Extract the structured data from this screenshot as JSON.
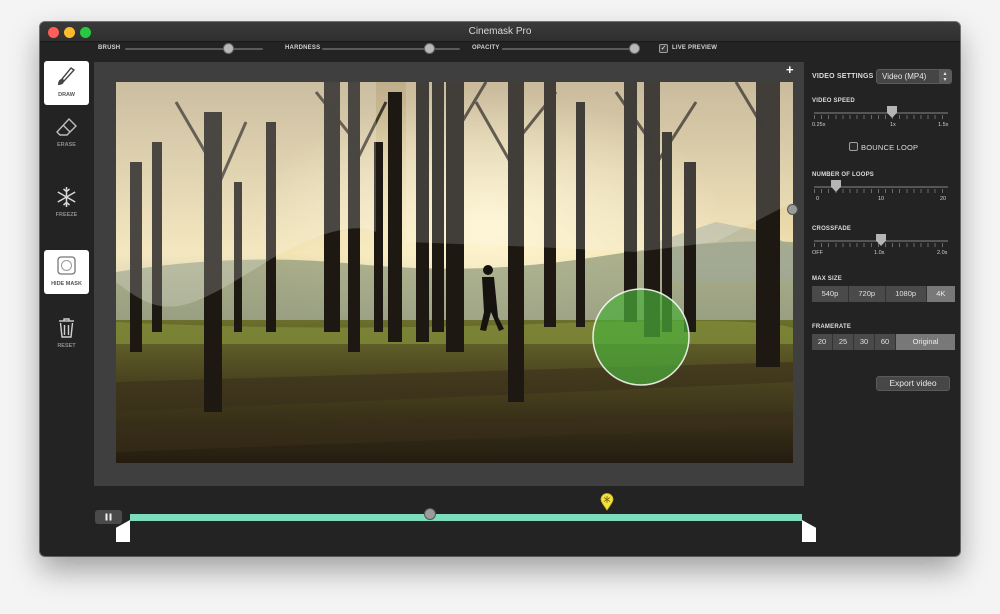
{
  "window": {
    "title": "Cinemask Pro"
  },
  "toolbar": {
    "brush_label": "BRUSH",
    "hardness_label": "HARDNESS",
    "opacity_label": "OPACITY",
    "live_preview_label": "LIVE PREVIEW",
    "live_preview_checked": true
  },
  "tools": [
    {
      "label": "DRAW",
      "icon": "brush-icon",
      "active": true
    },
    {
      "label": "ERASE",
      "icon": "eraser-icon",
      "active": false
    },
    {
      "label": "FREEZE",
      "icon": "snowflake-icon",
      "active": false
    },
    {
      "label": "HIDE MASK",
      "icon": "hide-mask-icon",
      "active": true
    },
    {
      "label": "RESET",
      "icon": "trash-icon",
      "active": false
    }
  ],
  "panel": {
    "video_settings_label": "VIDEO SETTINGS",
    "format_value": "Video (MP4)",
    "video_speed": {
      "label": "VIDEO SPEED",
      "min": "0.25x",
      "mid": "1x",
      "max": "1.5x"
    },
    "bounce_loop": {
      "label": "BOUNCE LOOP",
      "checked": false
    },
    "loops": {
      "label": "NUMBER OF LOOPS",
      "min": "0",
      "mid": "10",
      "max": "20"
    },
    "crossfade": {
      "label": "CROSSFADE",
      "min": "OFF",
      "mid": "1.0s",
      "max": "2.0s"
    },
    "max_size": {
      "label": "MAX SIZE",
      "options": [
        "540p",
        "720p",
        "1080p",
        "4K"
      ],
      "selected": "4K"
    },
    "framerate": {
      "label": "FRAMERATE",
      "options": [
        "20",
        "25",
        "30",
        "60",
        "Original"
      ],
      "selected": "Original"
    },
    "export_label": "Export video"
  },
  "colors": {
    "timeline": "#7ddcbb",
    "mask_green": "#4cae3a",
    "marker_yellow": "#f3e23b"
  }
}
